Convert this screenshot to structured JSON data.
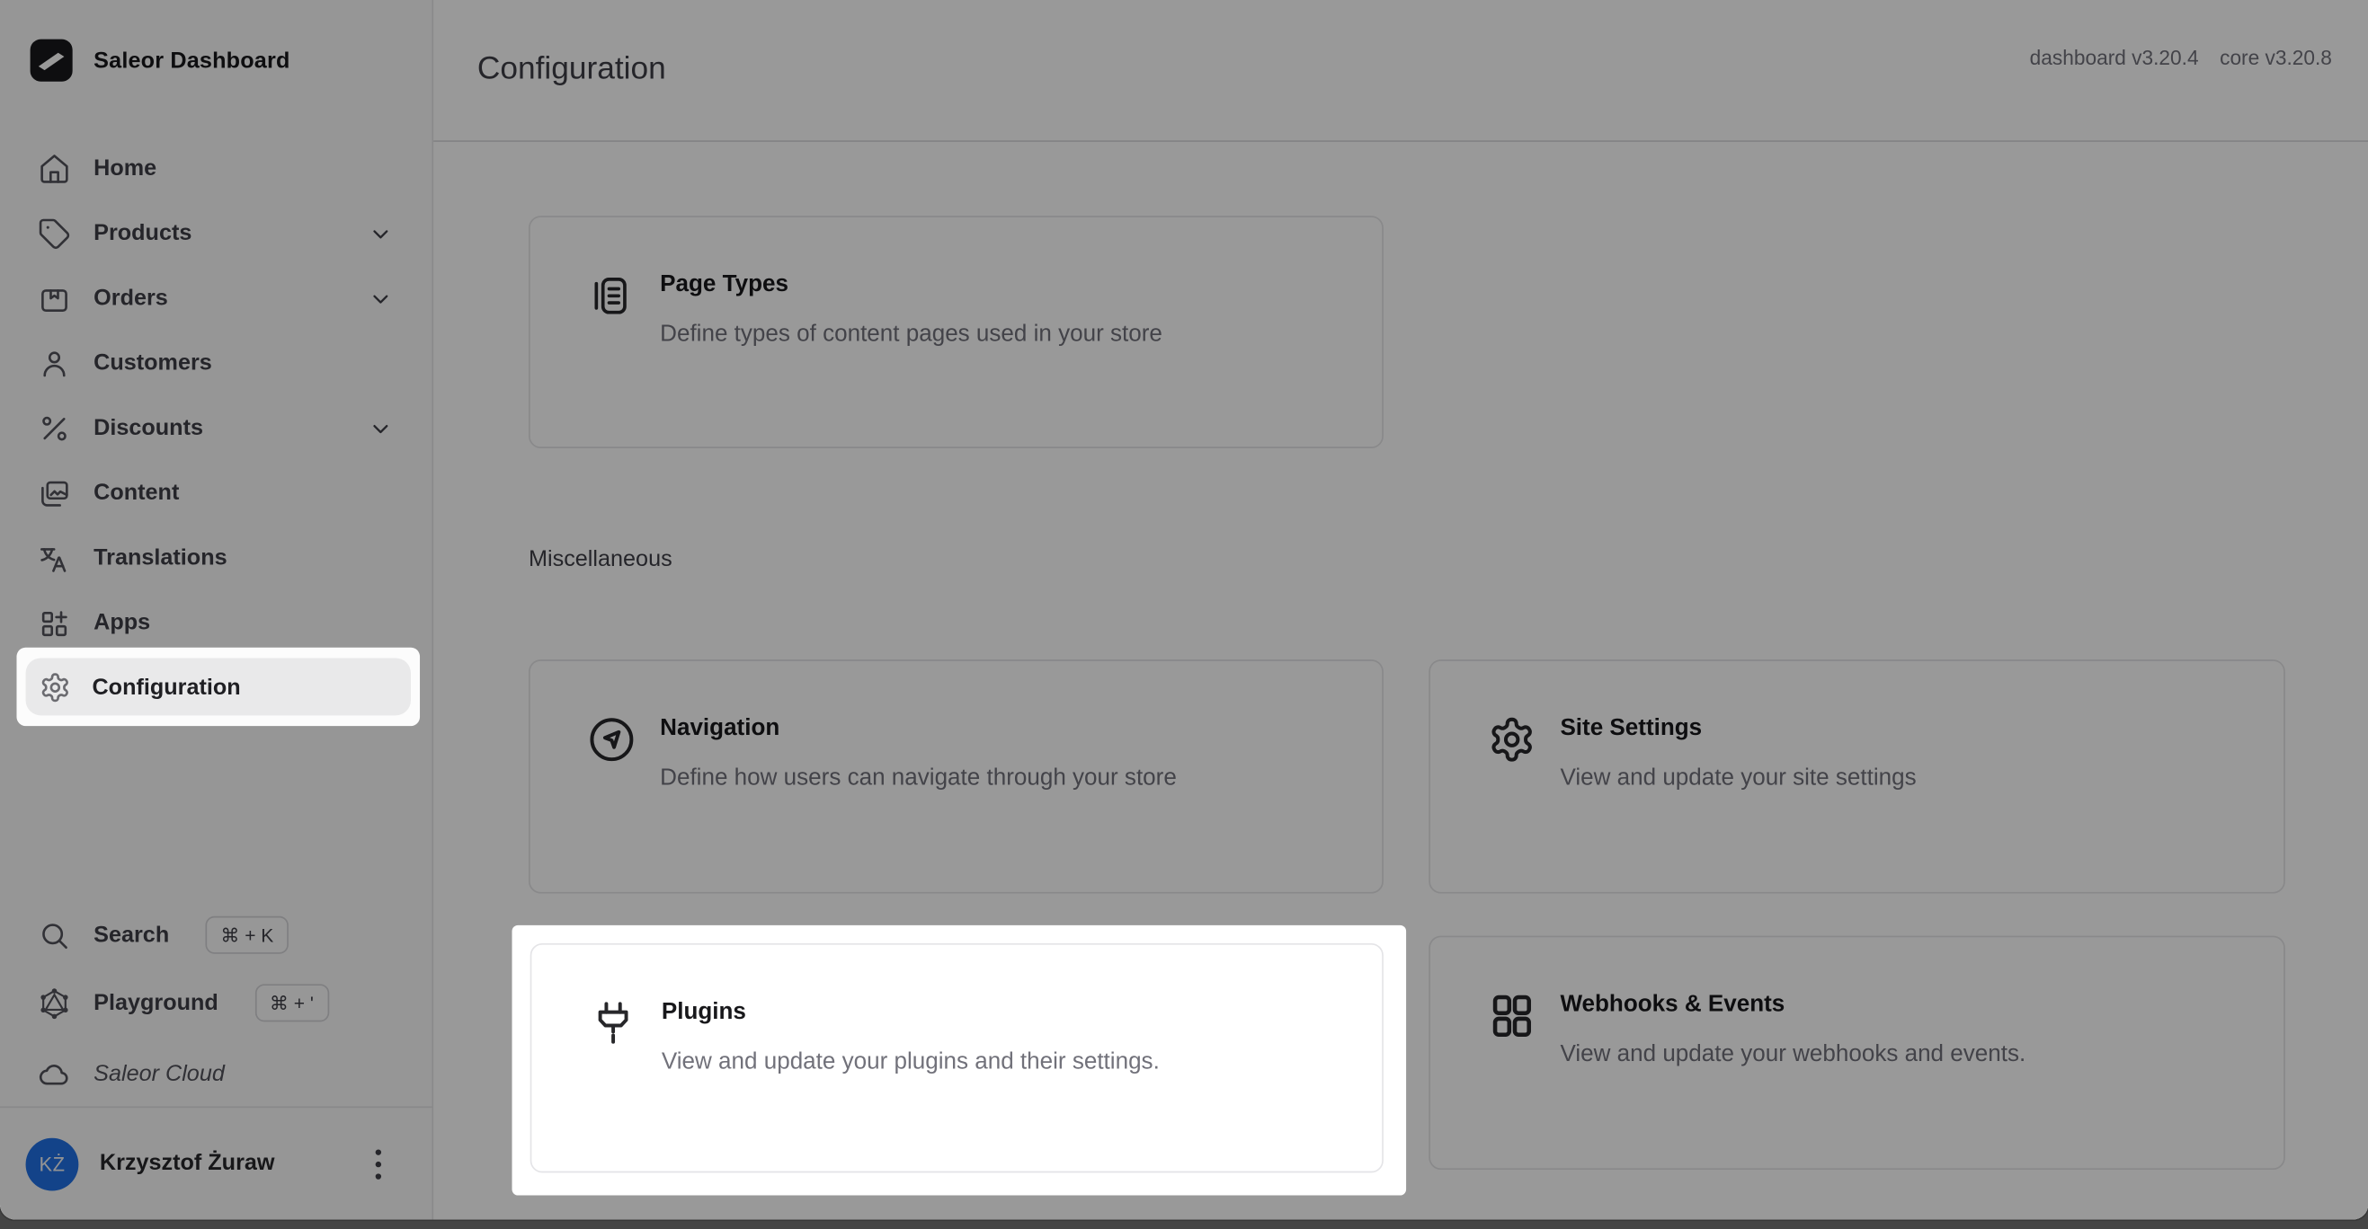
{
  "brand": {
    "name": "Saleor Dashboard"
  },
  "sidebar": {
    "items": [
      {
        "label": "Home",
        "icon": "home-icon",
        "expandable": false
      },
      {
        "label": "Products",
        "icon": "tag-icon",
        "expandable": true
      },
      {
        "label": "Orders",
        "icon": "package-icon",
        "expandable": true
      },
      {
        "label": "Customers",
        "icon": "person-icon",
        "expandable": false
      },
      {
        "label": "Discounts",
        "icon": "percent-icon",
        "expandable": true
      },
      {
        "label": "Content",
        "icon": "images-icon",
        "expandable": false
      },
      {
        "label": "Translations",
        "icon": "translate-icon",
        "expandable": false
      },
      {
        "label": "Apps",
        "icon": "apps-grid-plus-icon",
        "expandable": false
      },
      {
        "label": "Configuration",
        "icon": "gear-icon",
        "expandable": false,
        "active": true,
        "spotlighted": true
      }
    ],
    "utility": {
      "search": {
        "label": "Search",
        "shortcut": "⌘ + K",
        "icon": "search-icon"
      },
      "playground": {
        "label": "Playground",
        "shortcut": "⌘ + '",
        "icon": "graphql-icon"
      },
      "cloud": {
        "label": "Saleor Cloud",
        "icon": "cloud-icon"
      }
    },
    "user": {
      "name": "Krzysztof Żuraw",
      "initials": "KŻ"
    }
  },
  "header": {
    "title": "Configuration",
    "dashboard_version": "dashboard v3.20.4",
    "core_version": "core v3.20.8"
  },
  "content": {
    "sections": {
      "miscellaneous": "Miscellaneous"
    },
    "cards": {
      "page_types": {
        "title": "Page Types",
        "description": "Define types of content pages used in your store",
        "icon": "page-document-icon"
      },
      "navigation": {
        "title": "Navigation",
        "description": "Define how users can navigate through your store",
        "icon": "navigation-compass-icon"
      },
      "site_settings": {
        "title": "Site Settings",
        "description": "View and update your site settings",
        "icon": "cog-icon"
      },
      "plugins": {
        "title": "Plugins",
        "description": "View and update your plugins and their settings.",
        "icon": "plug-icon",
        "spotlighted": true
      },
      "webhooks": {
        "title": "Webhooks & Events",
        "description": "View and update your webhooks and events.",
        "icon": "grid-2x2-icon"
      }
    }
  },
  "colors": {
    "avatar_blue": "#2070e4",
    "sidebar_bg": "#fafafa",
    "border": "#e4e4e7",
    "overlay": "rgba(0,0,0,0.40)",
    "spotlight_bg": "#ffffff",
    "text_primary": "#18181b",
    "text_secondary": "#71717a"
  }
}
